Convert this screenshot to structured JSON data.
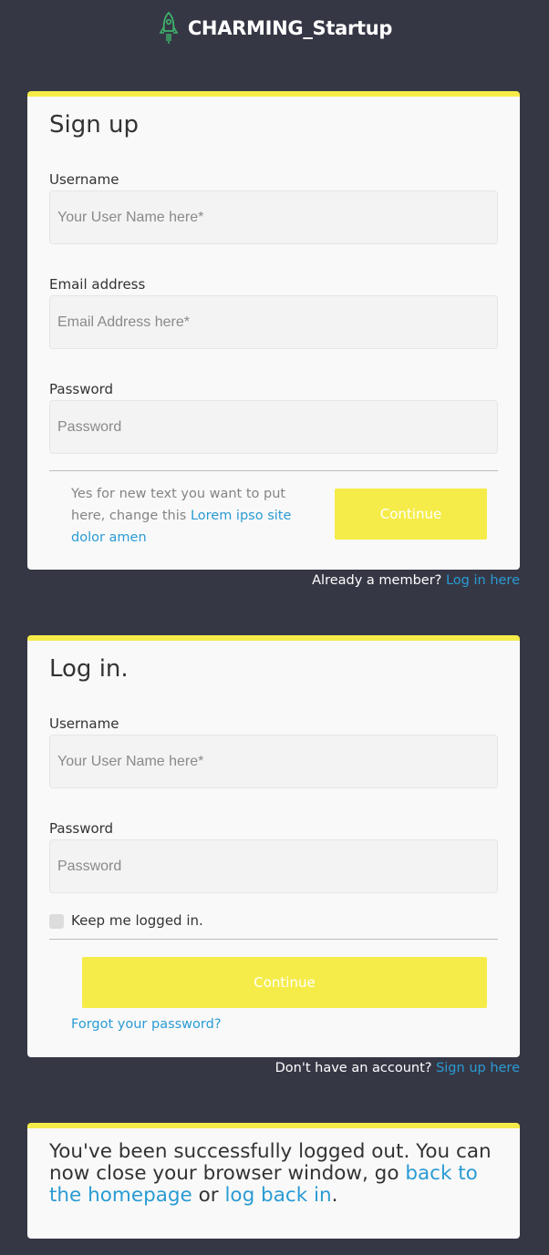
{
  "brand": {
    "name": "CHARMING_Startup",
    "icon": "rocket-icon"
  },
  "colors": {
    "background": "#363745",
    "accent": "#f5ec4a",
    "link": "#2a9bd3",
    "card": "#f9f9f9"
  },
  "signup": {
    "title": "Sign up",
    "username_label": "Username",
    "username_placeholder": "Your User Name here*",
    "email_label": "Email address",
    "email_placeholder": "Email Address here*",
    "password_label": "Password",
    "password_placeholder": "Password",
    "note_text": "Yes for new text you want to put here, change this ",
    "note_link": "Lorem ipso site dolor amen",
    "continue_label": "Continue",
    "member_text": "Already a member? ",
    "member_link": "Log in here"
  },
  "login": {
    "title": "Log in.",
    "username_label": "Username",
    "username_placeholder": "Your User Name here*",
    "password_label": "Password",
    "password_placeholder": "Password",
    "keep_logged_label": "Keep me logged in.",
    "continue_label": "Continue",
    "forgot_link": "Forgot your password?",
    "no_account_text": "Don't have an account? ",
    "signup_link": "Sign up here"
  },
  "logout": {
    "text_1": "You've been successfully logged out. You can now close your browser window, go ",
    "link_home": "back to the homepage",
    "text_2": " or ",
    "link_login": "log back in",
    "text_3": "."
  }
}
